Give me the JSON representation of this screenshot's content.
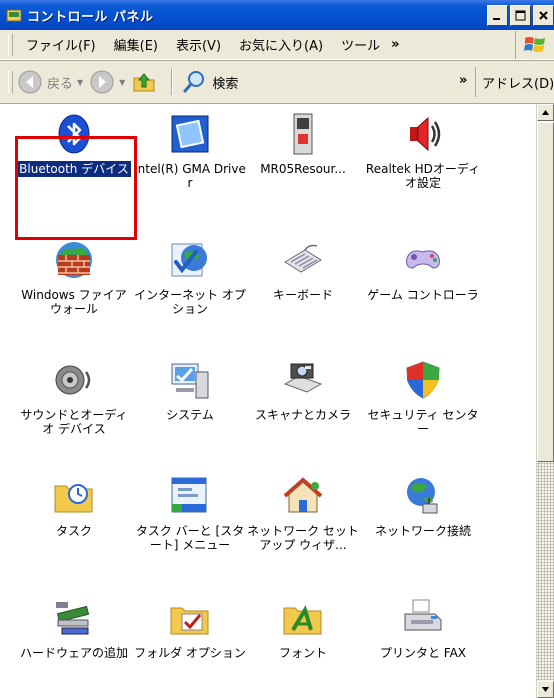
{
  "window": {
    "title": "コントロール パネル"
  },
  "menu": {
    "items": [
      "ファイル(F)",
      "編集(E)",
      "表示(V)",
      "お気に入り(A)",
      "ツール"
    ],
    "overflow": "»"
  },
  "toolbar": {
    "back": "戻る",
    "search": "検索",
    "overflow": "»",
    "address": "アドレス(D)"
  },
  "items": [
    {
      "label": "Bluetooth デバイス",
      "icon": "bluetooth-icon",
      "selected": true
    },
    {
      "label": "Intel(R) GMA Driver",
      "icon": "intel-gma-icon"
    },
    {
      "label": "MR05Resour...",
      "icon": "mr05-icon"
    },
    {
      "label": "Realtek HDオーディオ設定",
      "icon": "speaker-icon"
    },
    {
      "label": "Windows ファイアウォール",
      "icon": "firewall-icon"
    },
    {
      "label": "インターネット オプション",
      "icon": "internet-options-icon"
    },
    {
      "label": "キーボード",
      "icon": "keyboard-icon"
    },
    {
      "label": "ゲーム コントローラ",
      "icon": "game-controller-icon"
    },
    {
      "label": "サウンドとオーディオ デバイス",
      "icon": "sound-icon"
    },
    {
      "label": "システム",
      "icon": "system-icon"
    },
    {
      "label": "スキャナとカメラ",
      "icon": "scanner-camera-icon"
    },
    {
      "label": "セキュリティ センター",
      "icon": "security-shield-icon"
    },
    {
      "label": "タスク",
      "icon": "task-folder-icon"
    },
    {
      "label": "タスク バーと [スタート] メニュー",
      "icon": "taskbar-icon"
    },
    {
      "label": "ネットワーク セットアップ ウィザ...",
      "icon": "network-setup-icon"
    },
    {
      "label": "ネットワーク接続",
      "icon": "network-connection-icon"
    },
    {
      "label": "ハードウェアの追加",
      "icon": "add-hardware-icon"
    },
    {
      "label": "フォルダ オプション",
      "icon": "folder-options-icon"
    },
    {
      "label": "フォント",
      "icon": "fonts-folder-icon"
    },
    {
      "label": "プリンタと FAX",
      "icon": "printer-fax-icon"
    }
  ]
}
